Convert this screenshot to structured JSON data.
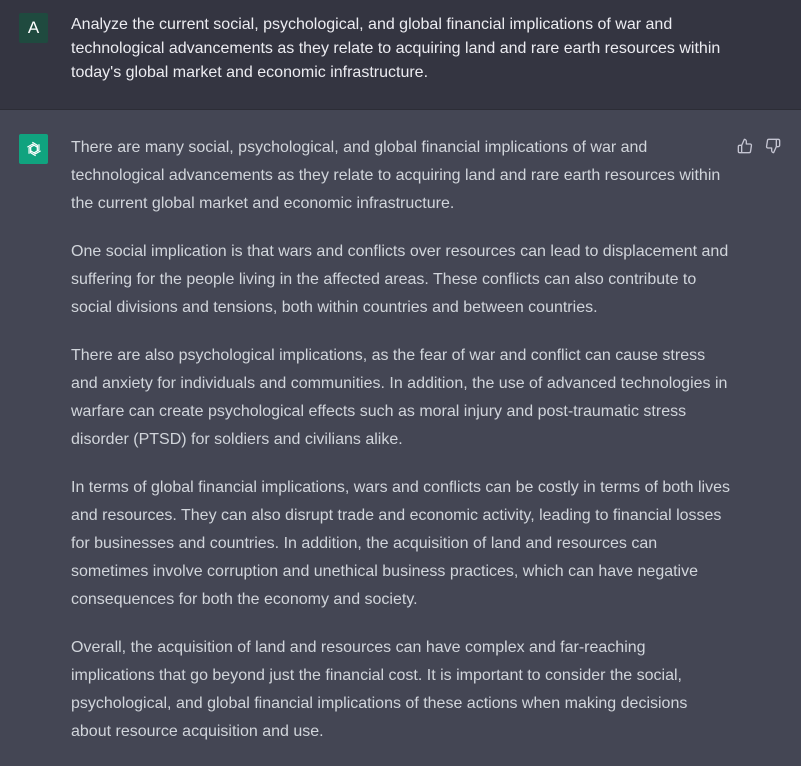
{
  "user": {
    "avatar_letter": "A",
    "message": "Analyze the current social, psychological, and global financial implications of war and technological advancements as they relate to acquiring land and rare earth resources within today's global market and economic infrastructure."
  },
  "assistant": {
    "avatar_icon": "openai-logo-icon",
    "paragraphs": [
      "There are many social, psychological, and global financial implications of war and technological advancements as they relate to acquiring land and rare earth resources within the current global market and economic infrastructure.",
      "One social implication is that wars and conflicts over resources can lead to displacement and suffering for the people living in the affected areas. These conflicts can also contribute to social divisions and tensions, both within countries and between countries.",
      "There are also psychological implications, as the fear of war and conflict can cause stress and anxiety for individuals and communities. In addition, the use of advanced technologies in warfare can create psychological effects such as moral injury and post-traumatic stress disorder (PTSD) for soldiers and civilians alike.",
      "In terms of global financial implications, wars and conflicts can be costly in terms of both lives and resources. They can also disrupt trade and economic activity, leading to financial losses for businesses and countries. In addition, the acquisition of land and resources can sometimes involve corruption and unethical business practices, which can have negative consequences for both the economy and society.",
      "Overall, the acquisition of land and resources can have complex and far-reaching implications that go beyond just the financial cost. It is important to consider the social, psychological, and global financial implications of these actions when making decisions about resource acquisition and use."
    ],
    "feedback_icons": [
      "thumbs-up-icon",
      "thumbs-down-icon"
    ]
  },
  "colors": {
    "user_bg": "#343541",
    "assistant_bg": "#444654",
    "bot_avatar": "#10a37f",
    "user_avatar": "#1f4a3f"
  }
}
